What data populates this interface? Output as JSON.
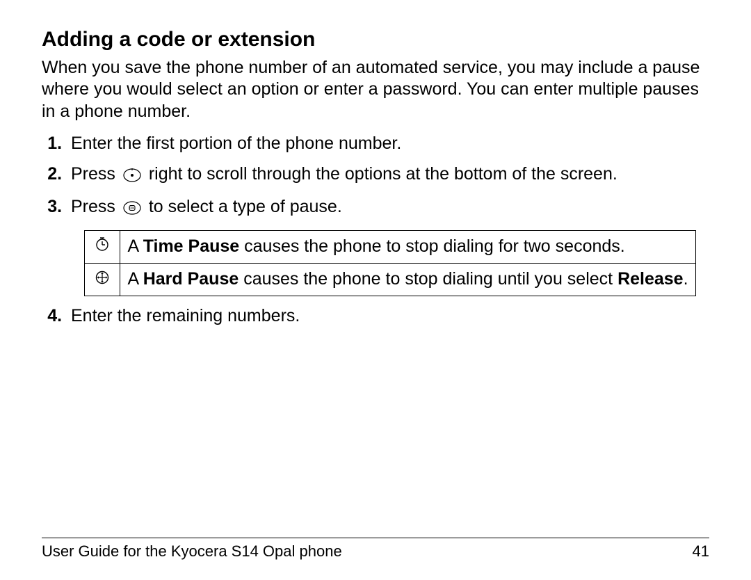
{
  "title": "Adding a code or extension",
  "intro": "When you save the phone number of an automated service, you may include a pause where you would select an option or enter a password. You can enter multiple pauses in a phone number.",
  "steps": {
    "s1": "Enter the first portion of the phone number.",
    "s2a": "Press ",
    "s2b": " right to scroll through the options at the bottom of the screen.",
    "s3a": "Press ",
    "s3b": " to select a type of pause.",
    "s4": "Enter the remaining numbers."
  },
  "table": {
    "row1": {
      "a": "A ",
      "bold": "Time Pause",
      "b": " causes the phone to stop dialing for two seconds."
    },
    "row2": {
      "a": "A ",
      "bold": "Hard Pause",
      "b": " causes the phone to stop dialing until you select ",
      "bold2": "Release",
      "c": "."
    }
  },
  "footer": {
    "left": "User Guide for the Kyocera S14 Opal phone",
    "right": "41"
  },
  "icons": {
    "nav": "nav-key-icon",
    "ok": "ok-key-icon",
    "time": "time-pause-icon",
    "hard": "hard-pause-icon"
  }
}
